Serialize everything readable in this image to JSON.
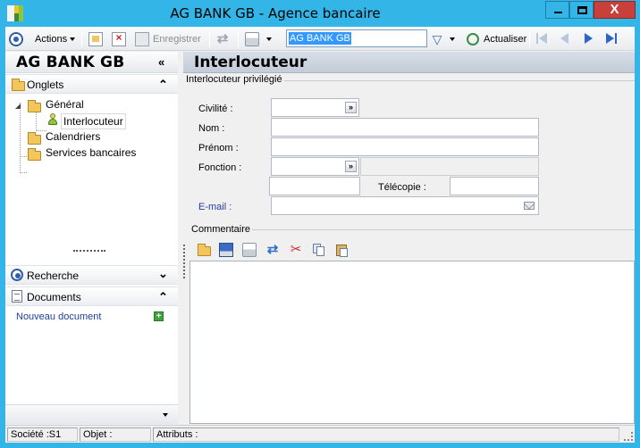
{
  "window": {
    "title": "AG BANK GB -  Agence bancaire",
    "close_glyph": "X"
  },
  "toolbar": {
    "actions_label": "Actions",
    "save_label": "Enregistrer",
    "search_value": "AG BANK GB",
    "refresh_label": "Actualiser"
  },
  "left_panel": {
    "title": "AG BANK GB",
    "collapse_glyph": "«",
    "onglets": {
      "label": "Onglets",
      "glyph": "⌃",
      "tree": [
        {
          "label": "Général"
        },
        {
          "label": "Interlocuteur"
        },
        {
          "label": "Calendriers"
        },
        {
          "label": "Services bancaires"
        }
      ]
    },
    "recherche": {
      "label": "Recherche",
      "glyph": "⌄"
    },
    "documents": {
      "label": "Documents",
      "glyph": "⌃",
      "new_doc": "Nouveau document"
    }
  },
  "main": {
    "title": "Interlocuteur",
    "group_label": "Interlocuteur privilégié",
    "fields": {
      "civilite": {
        "label": "Civilité :",
        "value": ""
      },
      "nom": {
        "label": "Nom :",
        "value": ""
      },
      "prenom": {
        "label": "Prénom :",
        "value": ""
      },
      "fonction": {
        "label": "Fonction :",
        "value": ""
      },
      "telecopie": {
        "label": "Télécopie :",
        "value": ""
      },
      "email": {
        "label": "E-mail :",
        "value": ""
      }
    },
    "comment_label": "Commentaire",
    "comment_text": ""
  },
  "statusbar": {
    "societe": "Société :S1",
    "objet": "Objet :",
    "attributs": "Attributs :"
  },
  "colors": {
    "titlebar": "#33b6e7",
    "close_button": "#c7403a",
    "selection": "#3399ff",
    "link": "#1f3f9a"
  }
}
